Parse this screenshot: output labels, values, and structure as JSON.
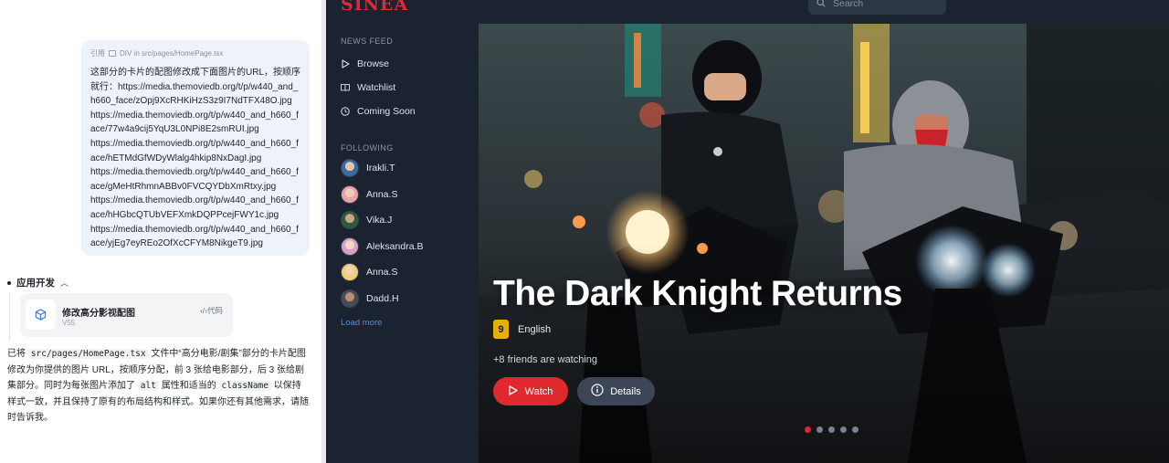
{
  "chat": {
    "quote_label": "引用",
    "quote_source": "DIV in src/pages/HomePage.tsx",
    "user_message": "这部分的卡片的配图修改成下面图片的URL，按顺序就行：https://media.themoviedb.org/t/p/w440_and_h660_face/zOpj9XcRHKiHzS3z9I7NdTFX48O.jpg\nhttps://media.themoviedb.org/t/p/w440_and_h660_face/77w4a9cij5YqU3L0NPi8E2smRUI.jpg\nhttps://media.themoviedb.org/t/p/w440_and_h660_face/hETMdGfWDyWlalg4hkip8NxDagI.jpg\nhttps://media.themoviedb.org/t/p/w440_and_h660_face/gMeHtRhmnABBv0FVCQYDbXmRtxy.jpg\nhttps://media.themoviedb.org/t/p/w440_and_h660_face/hHGbcQTUbVEFXmkDQPPcejFWY1c.jpg\nhttps://media.themoviedb.org/t/p/w440_and_h660_face/yjEg7eyREo2OfXcCFYM8NikgeT9.jpg",
    "section_title": "应用开发",
    "artifact": {
      "title": "修改高分影视配图",
      "version": "V55",
      "code_label": "代码"
    },
    "reply": {
      "p1": "已将",
      "code1": "src/pages/HomePage.tsx",
      "p2": "文件中“高分电影/剧集”部分的卡片配图修改为你提供的图片 URL，按顺序分配，前 3 张给电影部分，后 3 张给剧集部分。同时为每张图片添加了",
      "code2": "alt",
      "p3": "属性和适当的",
      "code3": "className",
      "p4": "以保持样式一致，并且保持了原有的布局结构和样式。如果你还有其他需求，请随时告诉我。"
    }
  },
  "app": {
    "logo": "SINEA",
    "search_placeholder": "Search",
    "news_feed_label": "NEWS FEED",
    "nav": [
      {
        "label": "Browse",
        "icon": "play-icon"
      },
      {
        "label": "Watchlist",
        "icon": "book-icon"
      },
      {
        "label": "Coming Soon",
        "icon": "clock-icon"
      }
    ],
    "following_label": "FOLLOWING",
    "friends": [
      {
        "name": "Irakli.T",
        "color": "#3b6aa8"
      },
      {
        "name": "Anna.S",
        "color": "#e9a3a8"
      },
      {
        "name": "Vika.J",
        "color": "#2e5a3a"
      },
      {
        "name": "Aleksandra.B",
        "color": "#d9a0c4"
      },
      {
        "name": "Anna.S",
        "color": "#f0cf7a"
      },
      {
        "name": "Dadd.H",
        "color": "#4a4a52"
      }
    ],
    "load_more": "Load more",
    "hero": {
      "title": "The Dark Knight Returns",
      "rating": "9",
      "language": "English",
      "friends_watching": "+8 friends are watching",
      "watch_label": "Watch",
      "details_label": "Details",
      "slides_total": 5,
      "active_slide": 1
    },
    "colors": {
      "accent": "#e0282e",
      "rating": "#e6b000",
      "link": "#4b8ef0",
      "background": "#1b2230"
    }
  }
}
